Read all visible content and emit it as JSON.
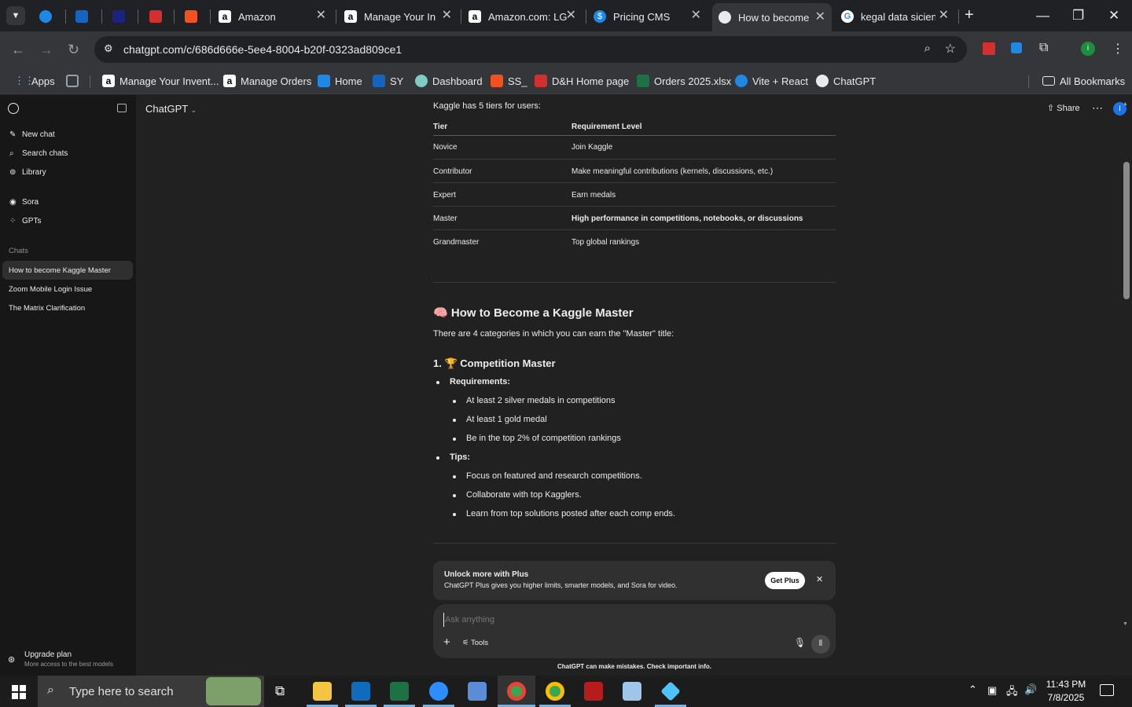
{
  "browser": {
    "tabs": [
      {
        "title": "",
        "icon": "app-icon"
      },
      {
        "title": "",
        "icon": "ec-icon"
      },
      {
        "title": "",
        "icon": "tw-icon"
      },
      {
        "title": "",
        "icon": "dh-icon"
      },
      {
        "title": "",
        "icon": "stack-icon"
      },
      {
        "title": "Amazon",
        "icon": "amazon-icon"
      },
      {
        "title": "Manage Your In",
        "icon": "amazon-icon"
      },
      {
        "title": "Amazon.com: LG",
        "icon": "amazon-icon"
      },
      {
        "title": "Pricing CMS",
        "icon": "dollar-icon"
      },
      {
        "title": "How to become",
        "icon": "chatgpt-icon"
      },
      {
        "title": "kegal data sicien",
        "icon": "google-icon"
      }
    ],
    "url": "chatgpt.com/c/686d666e-5ee4-8004-b20f-0323ad809ce1",
    "bookmarks": [
      {
        "label": "Apps"
      },
      {
        "label": ""
      },
      {
        "label": "Manage Your Invent..."
      },
      {
        "label": "Manage Orders"
      },
      {
        "label": "Home"
      },
      {
        "label": "SY"
      },
      {
        "label": "Dashboard"
      },
      {
        "label": "SS_"
      },
      {
        "label": "D&H Home page"
      },
      {
        "label": "Orders 2025.xlsx"
      },
      {
        "label": "Vite + React"
      },
      {
        "label": "ChatGPT"
      }
    ],
    "all_bookmarks": "All Bookmarks"
  },
  "sidebar": {
    "nav": [
      {
        "label": "New chat",
        "icon": "pencil-icon"
      },
      {
        "label": "Search chats",
        "icon": "search-icon"
      },
      {
        "label": "Library",
        "icon": "library-icon"
      },
      {
        "label": "Sora",
        "icon": "sora-icon"
      },
      {
        "label": "GPTs",
        "icon": "gpts-icon"
      }
    ],
    "chats_heading": "Chats",
    "chats": [
      {
        "label": "How to become Kaggle Master",
        "active": true
      },
      {
        "label": "Zoom Mobile Login Issue",
        "active": false
      },
      {
        "label": "The Matrix Clarification",
        "active": false
      }
    ],
    "upgrade": {
      "title": "Upgrade plan",
      "subtitle": "More access to the best models"
    }
  },
  "header": {
    "model": "ChatGPT",
    "share": "Share",
    "avatar": "I"
  },
  "message": {
    "intro": "Kaggle has 5 tiers for users:",
    "table": {
      "headers": [
        "Tier",
        "Requirement Level"
      ],
      "rows": [
        [
          "Novice",
          "Join Kaggle"
        ],
        [
          "Contributor",
          "Make meaningful contributions (kernels, discussions, etc.)"
        ],
        [
          "Expert",
          "Earn medals"
        ],
        [
          "Master",
          "High performance in competitions, notebooks, or discussions"
        ],
        [
          "Grandmaster",
          "Top global rankings"
        ]
      ]
    },
    "section_emoji": "🧠",
    "section_title": "How to Become a Kaggle Master",
    "section_text": "There are 4 categories in which you can earn the \"Master\" title:",
    "subsection": "1. 🏆 Competition Master",
    "requirements_label": "Requirements:",
    "requirements": [
      "At least 2 silver medals in competitions",
      "At least 1 gold medal",
      "Be in the top 2% of competition rankings"
    ],
    "tips_label": "Tips:",
    "tips": [
      "Focus on featured and research competitions.",
      "Collaborate with top Kagglers.",
      "Learn from top solutions posted after each comp ends."
    ]
  },
  "promo": {
    "title": "Unlock more with Plus",
    "text": "ChatGPT Plus gives you higher limits, smarter models, and Sora for video.",
    "button": "Get Plus"
  },
  "composer": {
    "placeholder": "Ask anything",
    "tools": "Tools"
  },
  "disclaimer": "ChatGPT can make mistakes. Check important info.",
  "taskbar": {
    "search_placeholder": "Type here to search",
    "time": "11:43 PM",
    "date": "7/8/2025"
  },
  "colors": {
    "accent": "#1a73e8",
    "sidebar_bg": "#171717",
    "main_bg": "#212121"
  }
}
